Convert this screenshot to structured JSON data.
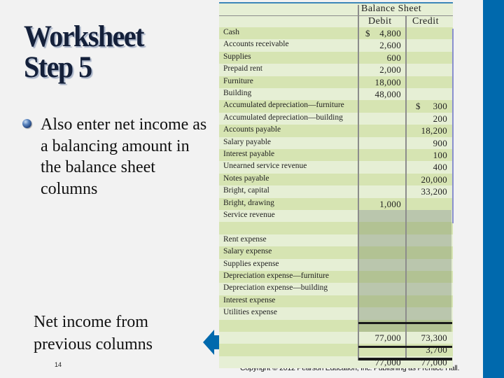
{
  "slide": {
    "title_lines": [
      "Worksheet",
      "Step 5"
    ],
    "bullet_text": "Also enter net income as a balancing amount in the balance sheet columns",
    "note_text": "Net income from previous columns",
    "page_number": "14",
    "copyright": "Copyright © 2012 Pearson Education, Inc. Publishing as Prentice Hall.",
    "colors": {
      "accent_bar": "#0069ad",
      "arrow": "#0069ad",
      "background": "#f2f2f2"
    }
  },
  "worksheet": {
    "section_header": "Balance Sheet",
    "columns": [
      "Debit",
      "Credit"
    ],
    "rows": [
      {
        "label": "Cash",
        "debit": "4,800",
        "debit_dollar": true,
        "credit": ""
      },
      {
        "label": "Accounts receivable",
        "debit": "2,600",
        "credit": ""
      },
      {
        "label": "Supplies",
        "debit": "600",
        "credit": ""
      },
      {
        "label": "Prepaid rent",
        "debit": "2,000",
        "credit": ""
      },
      {
        "label": "Furniture",
        "debit": "18,000",
        "credit": ""
      },
      {
        "label": "Building",
        "debit": "48,000",
        "credit": ""
      },
      {
        "label": "Accumulated depreciation—furniture",
        "debit": "",
        "credit": "300",
        "credit_dollar": true
      },
      {
        "label": "Accumulated depreciation—building",
        "debit": "",
        "credit": "200"
      },
      {
        "label": "Accounts payable",
        "debit": "",
        "credit": "18,200"
      },
      {
        "label": "Salary payable",
        "debit": "",
        "credit": "900"
      },
      {
        "label": "Interest payable",
        "debit": "",
        "credit": "100"
      },
      {
        "label": "Unearned service revenue",
        "debit": "",
        "credit": "400"
      },
      {
        "label": "Notes payable",
        "debit": "",
        "credit": "20,000"
      },
      {
        "label": "Bright, capital",
        "debit": "",
        "credit": "33,200"
      },
      {
        "label": "Bright, drawing",
        "debit": "1,000",
        "credit": ""
      },
      {
        "label": "Service revenue",
        "debit": "",
        "credit": ""
      },
      {
        "label": "",
        "debit": "",
        "credit": ""
      },
      {
        "label": "Rent expense",
        "debit": "",
        "credit": ""
      },
      {
        "label": "Salary expense",
        "debit": "",
        "credit": ""
      },
      {
        "label": "Supplies expense",
        "debit": "",
        "credit": ""
      },
      {
        "label": "Depreciation expense—furniture",
        "debit": "",
        "credit": ""
      },
      {
        "label": "Depreciation expense—building",
        "debit": "",
        "credit": ""
      },
      {
        "label": "Interest expense",
        "debit": "",
        "credit": ""
      },
      {
        "label": "Utilities expense",
        "debit": "",
        "credit": ""
      }
    ],
    "totals": [
      {
        "label": "",
        "debit": "77,000",
        "credit": "73,300"
      },
      {
        "label": "",
        "debit": "",
        "credit": "3,700"
      },
      {
        "label": "",
        "debit": "77,000",
        "credit": "77,000"
      }
    ]
  }
}
